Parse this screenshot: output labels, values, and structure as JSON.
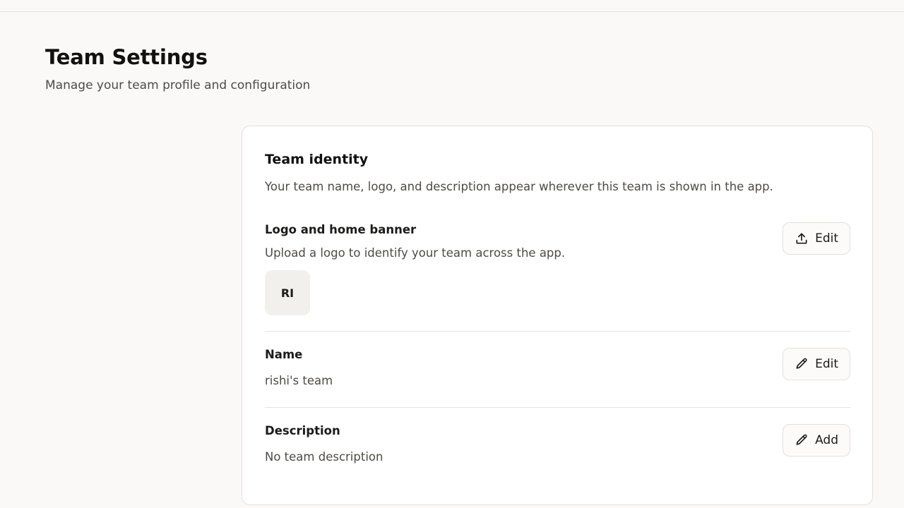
{
  "header": {
    "title": "Team Settings",
    "subtitle": "Manage your team profile and configuration"
  },
  "card": {
    "title": "Team identity",
    "description": "Your team name, logo, and description appear wherever this team is shown in the app.",
    "logo_section": {
      "label": "Logo and home banner",
      "helper": "Upload a logo to identify your team across the app.",
      "logo_initials": "RI",
      "button_label": "Edit",
      "button_icon": "upload-icon"
    },
    "name_section": {
      "label": "Name",
      "value": "rishi's team",
      "button_label": "Edit",
      "button_icon": "pencil-icon"
    },
    "description_section": {
      "label": "Description",
      "value": "No team description",
      "button_label": "Add",
      "button_icon": "pencil-icon"
    }
  }
}
